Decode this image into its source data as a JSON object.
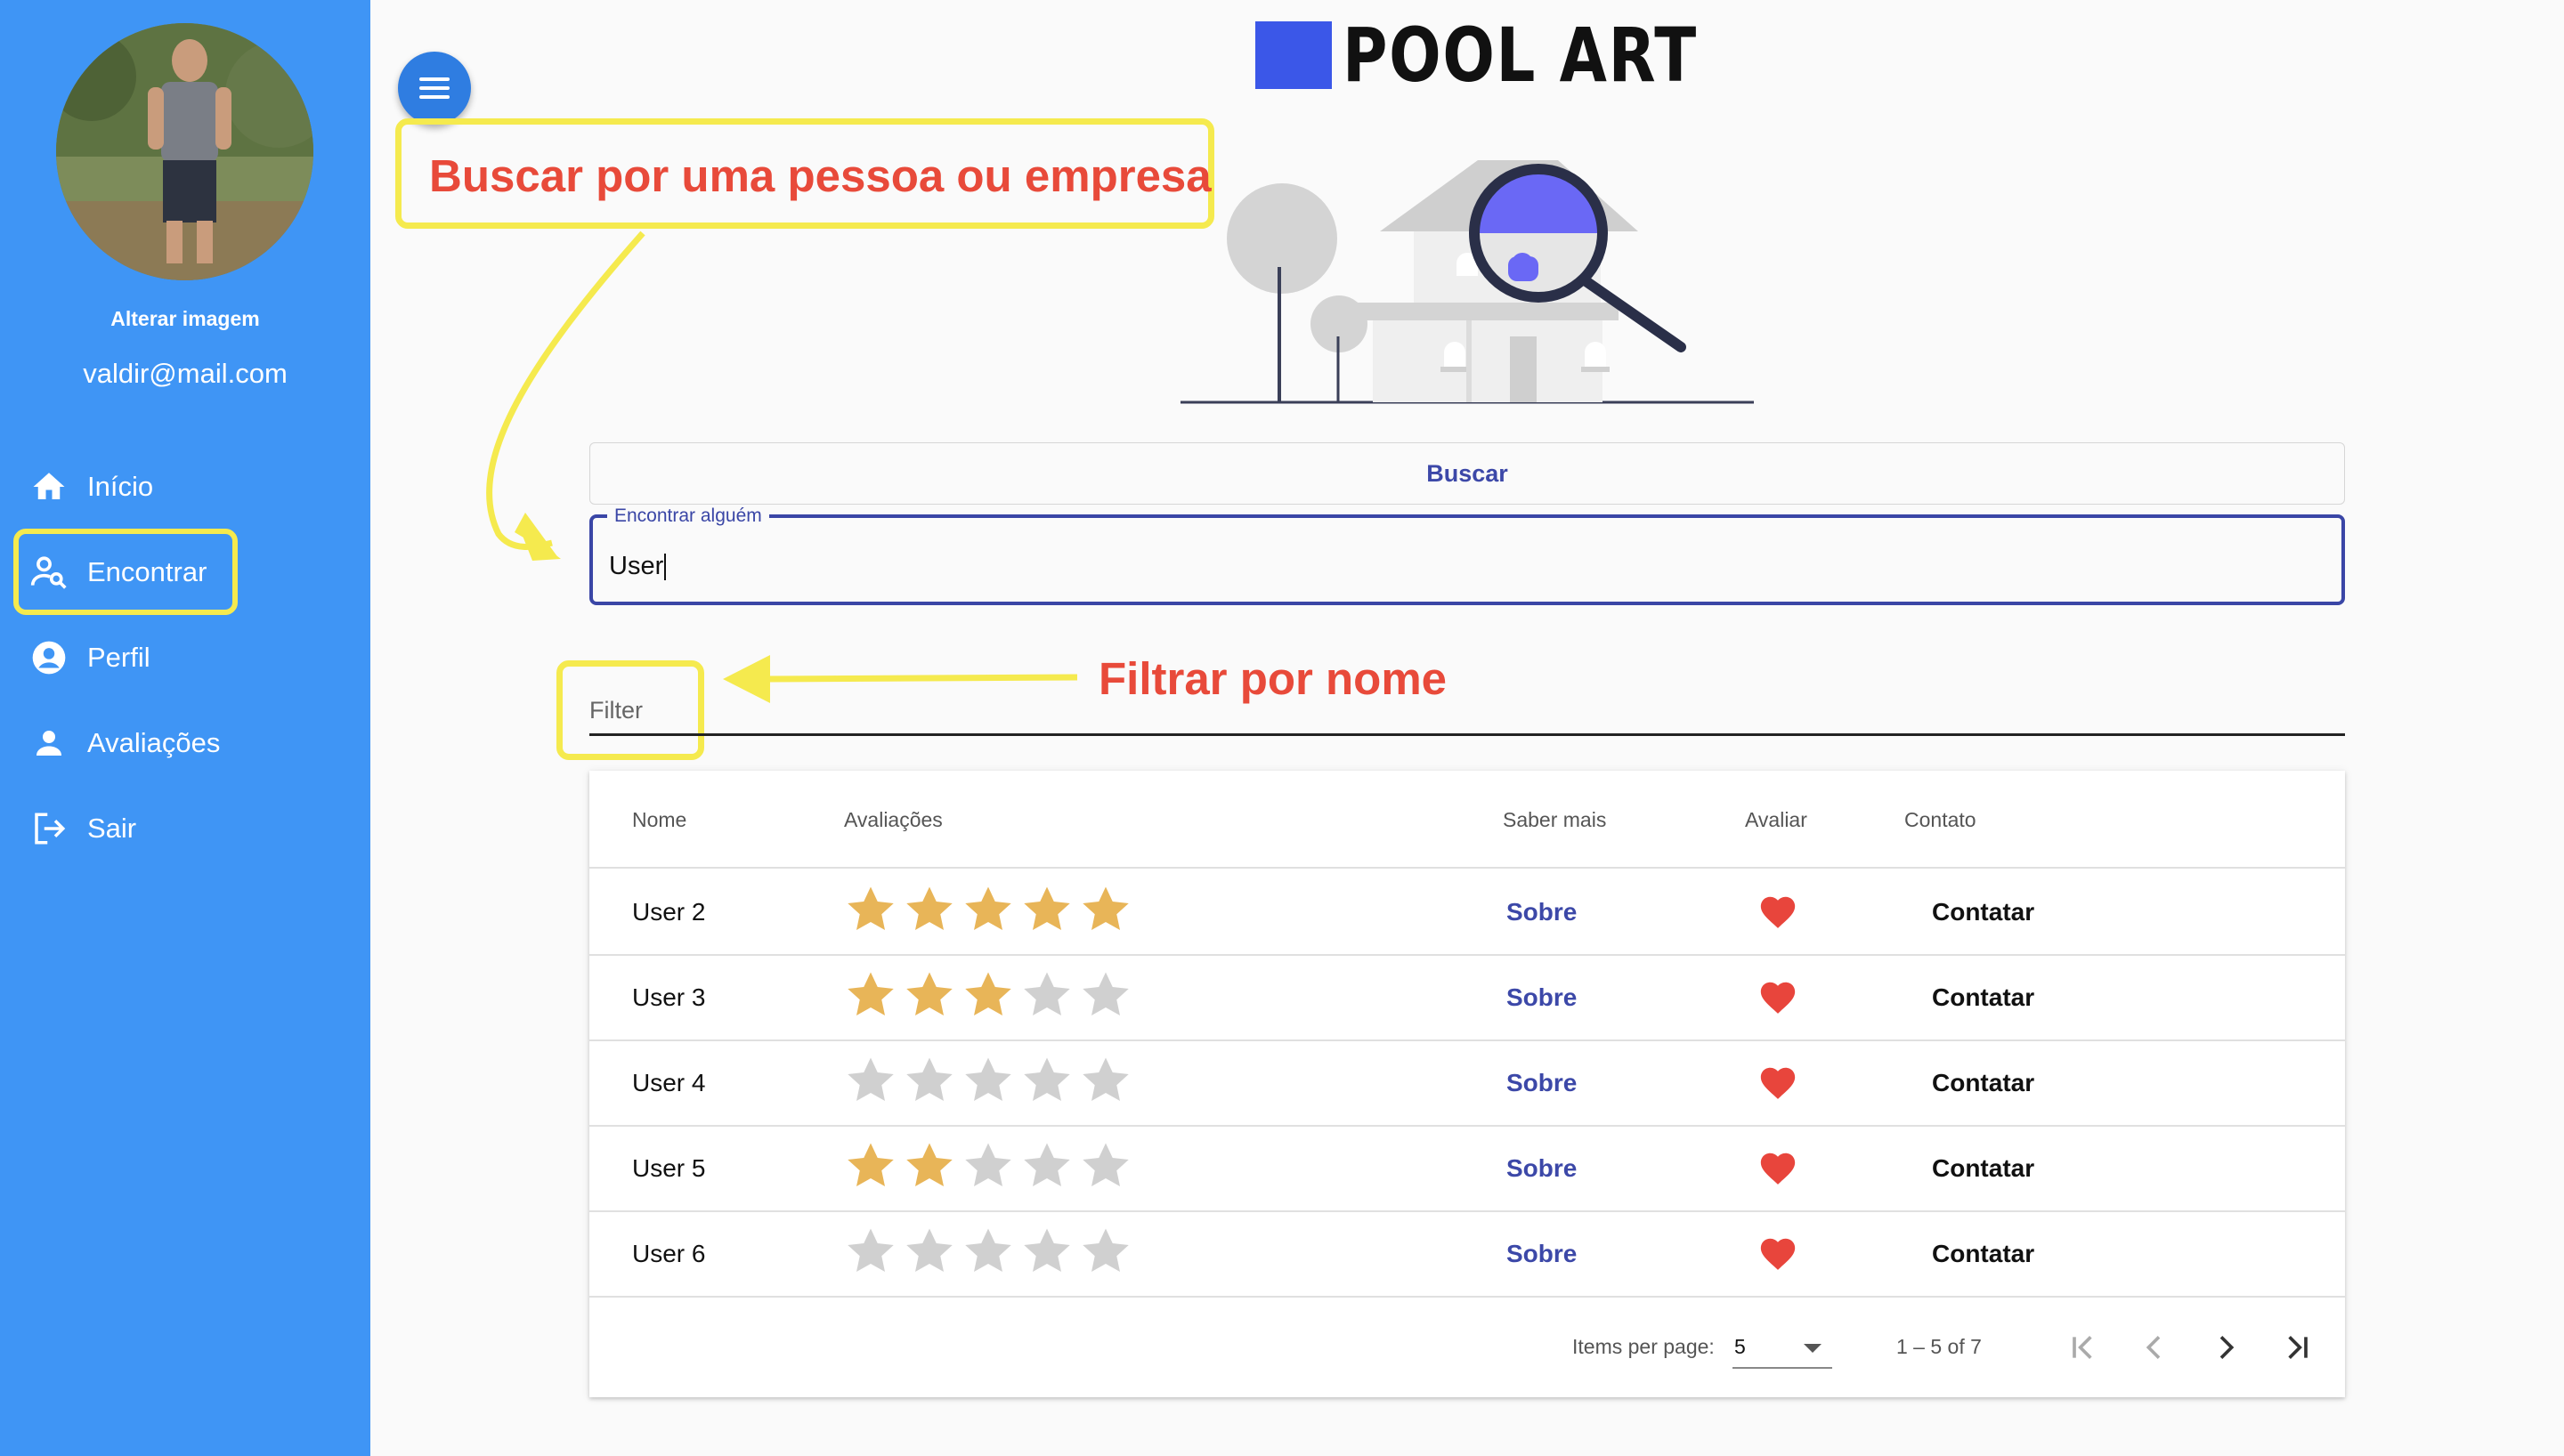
{
  "sidebar": {
    "change_image_label": "Alterar imagem",
    "email": "valdir@mail.com",
    "items": [
      {
        "label": "Início",
        "icon": "home-icon"
      },
      {
        "label": "Encontrar",
        "icon": "user-search-icon",
        "active": true
      },
      {
        "label": "Perfil",
        "icon": "account-circle-icon"
      },
      {
        "label": "Avaliações",
        "icon": "person-icon"
      },
      {
        "label": "Sair",
        "icon": "logout-icon"
      }
    ],
    "background_color": "#3f95f5"
  },
  "logo": {
    "text": "POOL ART",
    "mark_color": "#3b57e8"
  },
  "annotations": {
    "search_hint": "Buscar por uma pessoa ou empresa",
    "filter_hint": "Filtrar por nome"
  },
  "search": {
    "button_label": "Buscar",
    "field_label": "Encontrar alguém",
    "value": "User"
  },
  "filter": {
    "placeholder": "Filter"
  },
  "table": {
    "headers": [
      "Nome",
      "Avaliações",
      "Saber mais",
      "Avaliar",
      "Contato"
    ],
    "rows": [
      {
        "name": "User 2",
        "rating": 5,
        "more": "Sobre",
        "contact": "Contatar"
      },
      {
        "name": "User 3",
        "rating": 3,
        "more": "Sobre",
        "contact": "Contatar"
      },
      {
        "name": "User 4",
        "rating": 0,
        "more": "Sobre",
        "contact": "Contatar"
      },
      {
        "name": "User 5",
        "rating": 2,
        "more": "Sobre",
        "contact": "Contatar"
      },
      {
        "name": "User 6",
        "rating": 0,
        "more": "Sobre",
        "contact": "Contatar"
      }
    ],
    "max_rating": 5,
    "star_filled_color": "#e8b558",
    "star_empty_color": "#d0d0d0",
    "heart_color": "#e8453c"
  },
  "paginator": {
    "items_per_page_label": "Items per page:",
    "page_size": "5",
    "range_label": "1 – 5 of 7"
  }
}
